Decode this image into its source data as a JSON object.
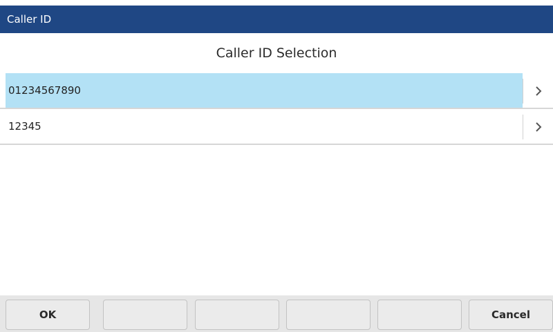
{
  "header": {
    "title": "Caller ID"
  },
  "page": {
    "title": "Caller ID Selection"
  },
  "list": {
    "items": [
      {
        "label": "01234567890",
        "selected": true
      },
      {
        "label": "12345",
        "selected": false
      }
    ]
  },
  "softkeys": [
    {
      "label": "OK"
    },
    {
      "label": ""
    },
    {
      "label": ""
    },
    {
      "label": ""
    },
    {
      "label": ""
    },
    {
      "label": "Cancel"
    }
  ],
  "colors": {
    "header_bg": "#1f4784",
    "selected_row_bg": "#b3e1f5",
    "softkey_bar_bg": "#e6e6e6"
  },
  "icons": {
    "row_action": "chevron-right-icon"
  }
}
